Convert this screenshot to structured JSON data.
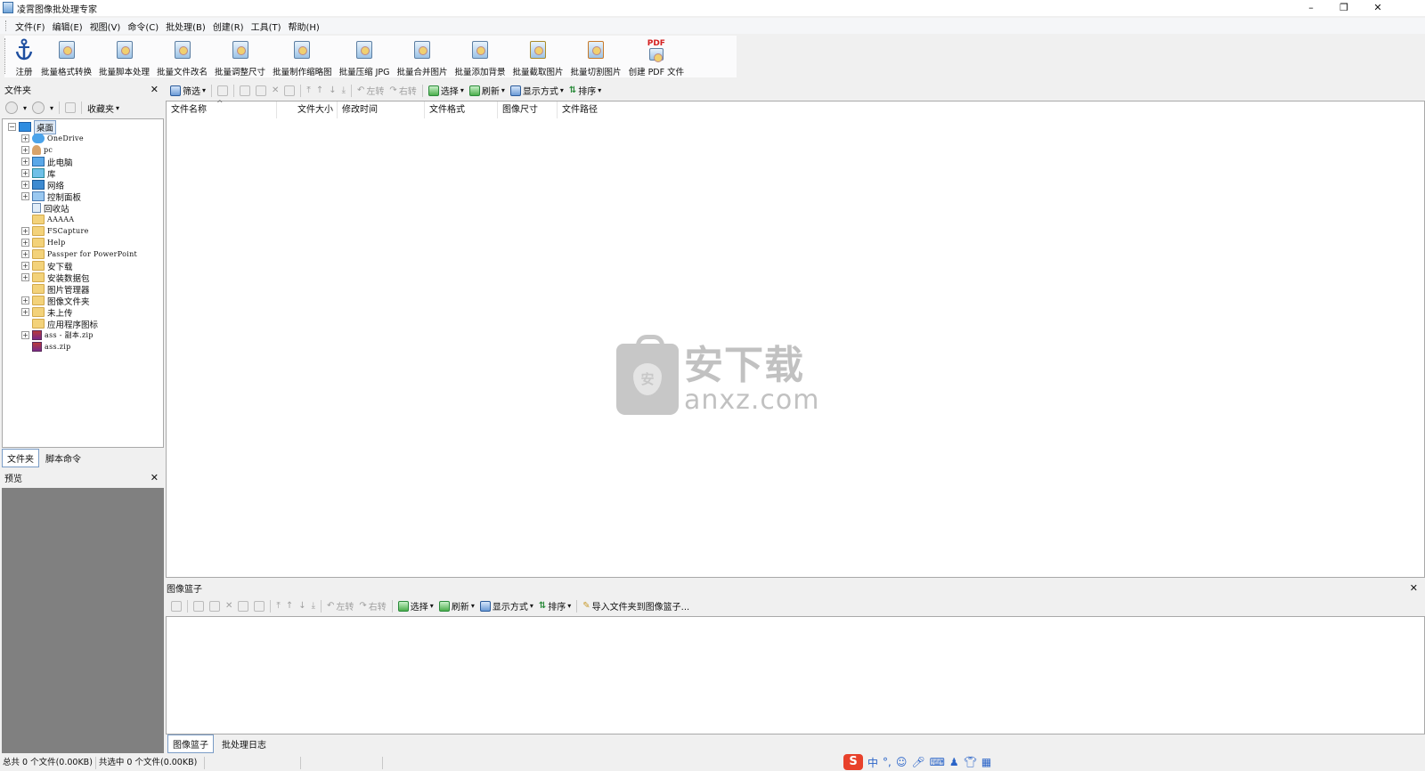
{
  "window": {
    "title": "凌霄图像批处理专家",
    "controls": {
      "minimize": "–",
      "restore": "❐",
      "close": "✕"
    }
  },
  "menu": [
    "文件(F)",
    "编辑(E)",
    "视图(V)",
    "命令(C)",
    "批处理(B)",
    "创建(R)",
    "工具(T)",
    "帮助(H)"
  ],
  "big_toolbar": [
    {
      "label": "注册",
      "icon": "anchor-icon"
    },
    {
      "label": "批量格式转换",
      "icon": "format-convert-icon"
    },
    {
      "label": "批量脚本处理",
      "icon": "script-process-icon"
    },
    {
      "label": "批量文件改名",
      "icon": "rename-icon"
    },
    {
      "label": "批量调整尺寸",
      "icon": "resize-icon"
    },
    {
      "label": "批量制作缩略图",
      "icon": "thumbnail-icon"
    },
    {
      "label": "批量压缩 JPG",
      "icon": "compress-jpg-icon"
    },
    {
      "label": "批量合并图片",
      "icon": "merge-icon"
    },
    {
      "label": "批量添加背景",
      "icon": "background-icon"
    },
    {
      "label": "批量截取图片",
      "icon": "crop-icon"
    },
    {
      "label": "批量切割图片",
      "icon": "cut-icon"
    },
    {
      "label": "创建 PDF 文件",
      "icon": "pdf-icon"
    }
  ],
  "folder_panel": {
    "title": "文件夹",
    "close": "✕",
    "favorites": "收藏夹",
    "tree": [
      {
        "label": "桌面",
        "level": 0,
        "expander": "−",
        "icon": "desktop",
        "selected": true
      },
      {
        "label": "OneDrive",
        "level": 1,
        "expander": "+",
        "icon": "cloud",
        "mono": true
      },
      {
        "label": "pc",
        "level": 1,
        "expander": "+",
        "icon": "user",
        "mono": true
      },
      {
        "label": "此电脑",
        "level": 1,
        "expander": "+",
        "icon": "computer"
      },
      {
        "label": "库",
        "level": 1,
        "expander": "+",
        "icon": "library"
      },
      {
        "label": "网络",
        "level": 1,
        "expander": "+",
        "icon": "network"
      },
      {
        "label": "控制面板",
        "level": 1,
        "expander": "+",
        "icon": "control-panel"
      },
      {
        "label": "回收站",
        "level": 1,
        "expander": "",
        "icon": "recycle-bin"
      },
      {
        "label": "AAAAA",
        "level": 1,
        "expander": "",
        "icon": "folder",
        "mono": true
      },
      {
        "label": "FSCapture",
        "level": 1,
        "expander": "+",
        "icon": "folder",
        "mono": true
      },
      {
        "label": "Help",
        "level": 1,
        "expander": "+",
        "icon": "folder",
        "mono": true
      },
      {
        "label": "Passper for PowerPoint",
        "level": 1,
        "expander": "+",
        "icon": "folder",
        "mono": true
      },
      {
        "label": "安下载",
        "level": 1,
        "expander": "+",
        "icon": "folder"
      },
      {
        "label": "安装数据包",
        "level": 1,
        "expander": "+",
        "icon": "folder"
      },
      {
        "label": "图片管理器",
        "level": 1,
        "expander": "",
        "icon": "folder"
      },
      {
        "label": "图像文件夹",
        "level": 1,
        "expander": "+",
        "icon": "folder"
      },
      {
        "label": "未上传",
        "level": 1,
        "expander": "+",
        "icon": "folder"
      },
      {
        "label": "应用程序图标",
        "level": 1,
        "expander": "",
        "icon": "folder"
      },
      {
        "label": "ass - 副本.zip",
        "level": 1,
        "expander": "+",
        "icon": "zip",
        "mono": true
      },
      {
        "label": "ass.zip",
        "level": 1,
        "expander": "",
        "icon": "zip",
        "mono": true
      }
    ],
    "tabs": [
      "文件夹",
      "脚本命令"
    ]
  },
  "preview_panel": {
    "title": "预览",
    "close": "✕"
  },
  "list_toolbar": {
    "filter": "筛选",
    "rotate_left": "左转",
    "rotate_right": "右转",
    "select": "选择",
    "refresh": "刷新",
    "display_mode": "显示方式",
    "sort": "排序"
  },
  "file_list": {
    "columns": [
      "文件名称",
      "文件大小",
      "修改时间",
      "文件格式",
      "图像尺寸",
      "文件路径"
    ],
    "sort_indicator": "^"
  },
  "watermark": {
    "cn": "安下载",
    "en": "anxz.com",
    "shield_char": "安"
  },
  "basket": {
    "title": "图像篮子",
    "close": "✕",
    "toolbar": {
      "rotate_left": "左转",
      "rotate_right": "右转",
      "select": "选择",
      "refresh": "刷新",
      "display_mode": "显示方式",
      "sort": "排序",
      "import": "导入文件夹到图像篮子..."
    },
    "tabs": [
      "图像篮子",
      "批处理日志"
    ]
  },
  "status": {
    "total": "总共 0 个文件(0.00KB)",
    "selected": "共选中 0 个文件(0.00KB)"
  },
  "ime": {
    "logo": "S",
    "mode": "中",
    "punct": "°,"
  }
}
